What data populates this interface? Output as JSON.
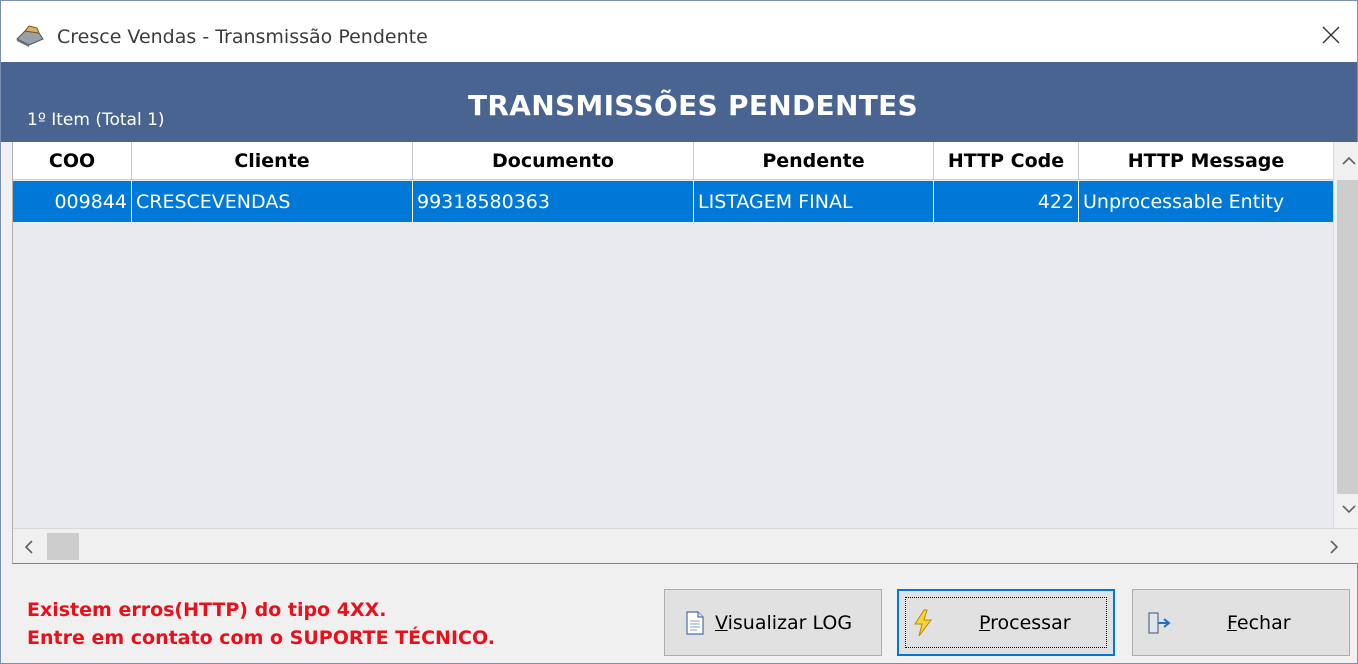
{
  "window": {
    "title": "Cresce Vendas - Transmissão Pendente"
  },
  "header": {
    "item_count": "1º Item (Total 1)",
    "title": "TRANSMISSÕES PENDENTES"
  },
  "grid": {
    "columns": [
      "COO",
      "Cliente",
      "Documento",
      "Pendente",
      "HTTP Code",
      "HTTP Message"
    ],
    "rows": [
      {
        "coo": "009844",
        "cliente": "CRESCEVENDAS",
        "documento": "99318580363",
        "pendente": "LISTAGEM FINAL",
        "http_code": "422",
        "http_message": "Unprocessable Entity"
      }
    ]
  },
  "message": {
    "line1": "Existem erros(HTTP) do tipo 4XX.",
    "line2": "Entre em contato com o SUPORTE TÉCNICO."
  },
  "buttons": {
    "log_mnemonic": "V",
    "log_rest": "isualizar LOG",
    "process_mnemonic": "P",
    "process_rest": "rocessar",
    "close_mnemonic": "F",
    "close_rest": "echar"
  },
  "colors": {
    "header_bg": "#4a6491",
    "selection": "#0078d7",
    "error_text": "#e8101b"
  },
  "icons": {
    "app": "cash-register-icon",
    "close": "close-icon",
    "log": "document-icon",
    "process": "lightning-icon",
    "exit": "exit-door-icon"
  }
}
